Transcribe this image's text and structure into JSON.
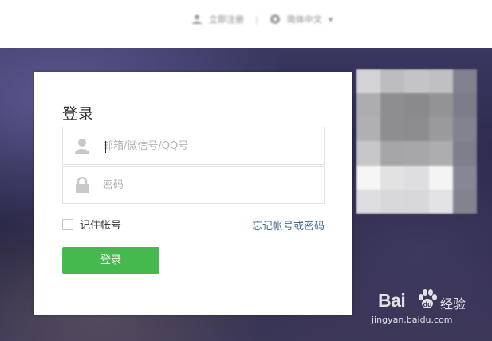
{
  "topbar": {
    "register_label": "立即注册",
    "language_label": "简体中文"
  },
  "login": {
    "title": "登录",
    "username_placeholder": "邮箱/微信号/QQ号",
    "password_placeholder": "密码",
    "remember_label": "记住帐号",
    "forgot_label": "忘记帐号或密码",
    "submit_label": "登录"
  },
  "watermark": {
    "brand_left": "Bai",
    "brand_right": "经验",
    "url": "jingyan.baidu.com"
  },
  "colors": {
    "primary_button": "#45b94d",
    "link": "#4a6c96"
  },
  "icons": {
    "user": "user-icon",
    "lock": "lock-icon",
    "globe": "globe-icon",
    "paw": "paw-icon"
  }
}
